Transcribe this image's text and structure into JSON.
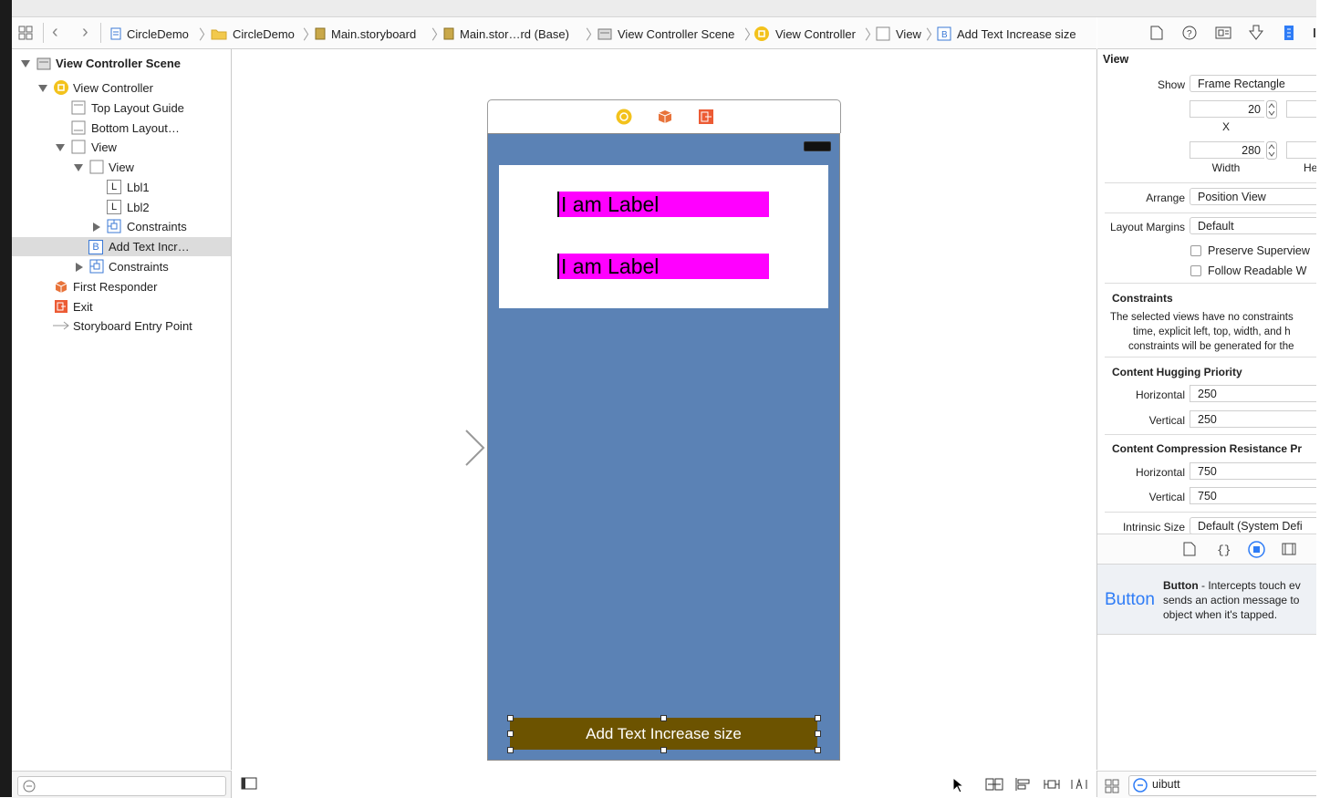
{
  "jumpbar": {
    "grid_icon": "related-items-icon",
    "back": "‹",
    "forward": "›",
    "crumbs": [
      {
        "label": "CircleDemo",
        "icon": "project-file-icon"
      },
      {
        "label": "CircleDemo",
        "icon": "folder-icon"
      },
      {
        "label": "Main.storyboard",
        "icon": "storyboard-icon"
      },
      {
        "label": "Main.stor…rd (Base)",
        "icon": "storyboard-icon"
      },
      {
        "label": "View Controller Scene",
        "icon": "scene-icon"
      },
      {
        "label": "View Controller",
        "icon": "view-controller-icon"
      },
      {
        "label": "View",
        "icon": "view-icon"
      },
      {
        "label": "Add Text Increase size",
        "icon": "button-icon"
      }
    ],
    "crumb_sep": "〉"
  },
  "outline": {
    "items": [
      {
        "label": "View Controller Scene",
        "icon_text": ""
      },
      {
        "label": "View Controller",
        "icon_text": ""
      },
      {
        "label": "Top Layout Guide",
        "icon_text": ""
      },
      {
        "label": "Bottom Layout…",
        "icon_text": ""
      },
      {
        "label": "View",
        "icon_text": ""
      },
      {
        "label": "View",
        "icon_text": ""
      },
      {
        "label": "Lbl1",
        "icon_text": "L"
      },
      {
        "label": "Lbl2",
        "icon_text": "L"
      },
      {
        "label": "Constraints",
        "icon_text": ""
      },
      {
        "label": "Add Text Incr…",
        "icon_text": "B"
      },
      {
        "label": "Constraints",
        "icon_text": ""
      },
      {
        "label": "First Responder",
        "icon_text": ""
      },
      {
        "label": "Exit",
        "icon_text": ""
      },
      {
        "label": "Storyboard Entry Point",
        "icon_text": ""
      }
    ]
  },
  "canvas": {
    "label1": "I am Label",
    "label2": "I am Label",
    "button": "Add Text Increase size",
    "colors": {
      "view_bg": "#5b82b5",
      "label_bg": "#ff00ff",
      "button_bg": "#6c5300"
    }
  },
  "inspector": {
    "section": "View",
    "show_label": "Show",
    "show_value": "Frame Rectangle",
    "x_value": "20",
    "x_label": "X",
    "width_value": "280",
    "width_label": "Width",
    "height_label_partial": "He",
    "arrange_label": "Arrange",
    "arrange_value": "Position View",
    "layout_margins_label": "Layout Margins",
    "layout_margins_value": "Default",
    "preserve": "Preserve Superview",
    "follow": "Follow Readable W",
    "constraints_title": "Constraints",
    "constraints_text_1": "The selected views have no constraints",
    "constraints_text_2": "time, explicit left, top, width, and h",
    "constraints_text_3": "constraints will be generated for the",
    "hugging_title": "Content Hugging Priority",
    "horizontal_label": "Horizontal",
    "vertical_label": "Vertical",
    "hugging_h": "250",
    "hugging_v": "250",
    "compression_title": "Content Compression Resistance Pr",
    "compression_h": "750",
    "compression_v": "750",
    "intrinsic_label": "Intrinsic Size",
    "intrinsic_value": "Default (System Defi",
    "library_title": "Button",
    "library_desc_1": " - Intercepts touch ev",
    "library_desc_2": "sends an action message to",
    "library_desc_3": "object when it's tapped.",
    "library_big": "Button",
    "filter_value": "uibutt"
  }
}
